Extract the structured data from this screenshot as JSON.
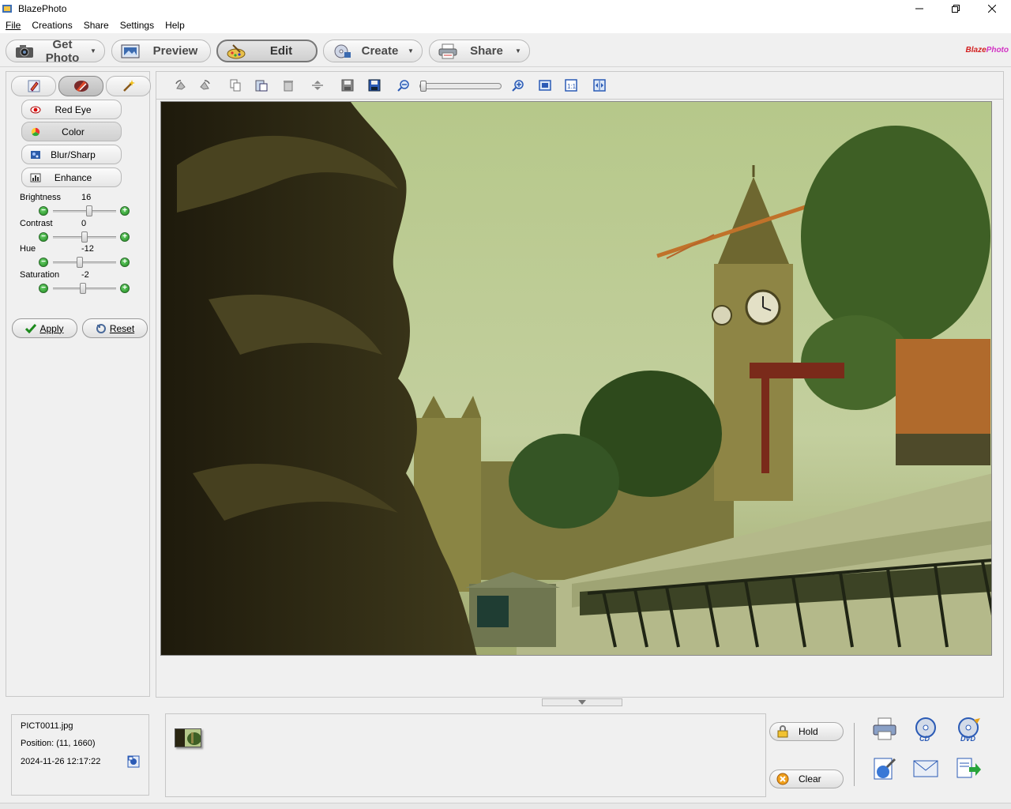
{
  "window": {
    "title": "BlazePhoto",
    "app_icon": "blazephoto-icon",
    "controls": [
      "minimize-icon",
      "maximize-icon",
      "close-icon"
    ]
  },
  "menu": {
    "items": [
      "File",
      "Creations",
      "Share",
      "Settings",
      "Help"
    ]
  },
  "main_toolbar": {
    "buttons": [
      {
        "label": "Get Photo",
        "icon": "camera-icon",
        "dropdown": true
      },
      {
        "label": "Preview",
        "icon": "preview-icon",
        "dropdown": false
      },
      {
        "label": "Edit",
        "icon": "paint-brush-icon",
        "dropdown": false,
        "active": true
      },
      {
        "label": "Create",
        "icon": "cd-create-icon",
        "dropdown": true
      },
      {
        "label": "Share",
        "icon": "printer-icon",
        "dropdown": true
      }
    ],
    "brand": "BlazePhoto"
  },
  "left_panel": {
    "tabs": [
      {
        "icon": "pencil-icon",
        "active": false
      },
      {
        "icon": "brush-tools-icon",
        "active": true
      },
      {
        "icon": "magic-wand-icon",
        "active": false
      }
    ],
    "tools": [
      {
        "label": "Red Eye",
        "icon": "eye-icon"
      },
      {
        "label": "Color",
        "icon": "color-wheel-icon",
        "active": true
      },
      {
        "label": "Blur/Sharp",
        "icon": "blur-icon"
      },
      {
        "label": "Enhance",
        "icon": "histogram-icon"
      }
    ],
    "adjustments": [
      {
        "label": "Brightness",
        "value": "16",
        "level": 0.58
      },
      {
        "label": "Contrast",
        "value": "0",
        "level": 0.5
      },
      {
        "label": "Hue",
        "value": "-12",
        "level": 0.42
      },
      {
        "label": "Saturation",
        "value": "-2",
        "level": 0.48
      }
    ],
    "apply_label": "Apply",
    "reset_label": "Reset"
  },
  "edit_toolbar": {
    "icons": [
      "rotate-left-icon",
      "rotate-right-icon",
      "copy-icon",
      "paste-icon",
      "delete-icon",
      "flip-icon",
      "save-icon",
      "save-as-icon",
      "zoom-out-icon",
      "zoom-in-icon",
      "fit-window-icon",
      "actual-size-icon",
      "fit-width-icon"
    ],
    "zoom_level": 0.0
  },
  "file_info": {
    "filename": "PICT0011.jpg",
    "position": "Position: (11, 1660)",
    "datetime": "2024-11-26 12:17:22",
    "info_icon": "properties-icon"
  },
  "tray": {
    "hold_label": "Hold",
    "clear_label": "Clear"
  },
  "output_icons": [
    "print-icon",
    "burn-cd-icon",
    "burn-dvd-icon",
    "html-gallery-icon",
    "email-icon",
    "export-icon"
  ],
  "colors": {
    "accent_green": "#1d8a1d",
    "photo_tint": "#b9c58f"
  }
}
